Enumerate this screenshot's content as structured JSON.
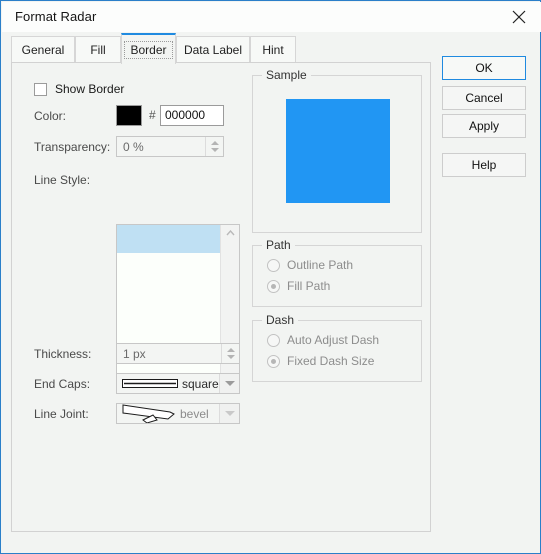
{
  "window": {
    "title": "Format Radar",
    "close_icon": "close-icon"
  },
  "tabs": [
    {
      "label": "General",
      "active": false
    },
    {
      "label": "Fill",
      "active": false
    },
    {
      "label": "Border",
      "active": true
    },
    {
      "label": "Data Label",
      "active": false
    },
    {
      "label": "Hint",
      "active": false
    }
  ],
  "border": {
    "show_border": {
      "label": "Show Border",
      "checked": false
    },
    "color": {
      "label": "Color:",
      "hash": "#",
      "value": "000000",
      "swatch_hex": "#000000"
    },
    "transparency": {
      "label": "Transparency:",
      "value": "0 %"
    },
    "line_style": {
      "label": "Line Style:",
      "selected_index": 0
    },
    "thickness": {
      "label": "Thickness:",
      "value": "1 px"
    },
    "end_caps": {
      "label": "End Caps:",
      "value": "square"
    },
    "line_joint": {
      "label": "Line Joint:",
      "value": "bevel"
    }
  },
  "sample": {
    "title": "Sample",
    "fill_color": "#2196f3"
  },
  "path": {
    "title": "Path",
    "options": [
      {
        "label": "Outline Path",
        "selected": false
      },
      {
        "label": "Fill Path",
        "selected": true
      }
    ]
  },
  "dash": {
    "title": "Dash",
    "options": [
      {
        "label": "Auto Adjust Dash",
        "selected": false
      },
      {
        "label": "Fixed Dash Size",
        "selected": true
      }
    ]
  },
  "buttons": {
    "ok": "OK",
    "cancel": "Cancel",
    "apply": "Apply",
    "help": "Help"
  }
}
